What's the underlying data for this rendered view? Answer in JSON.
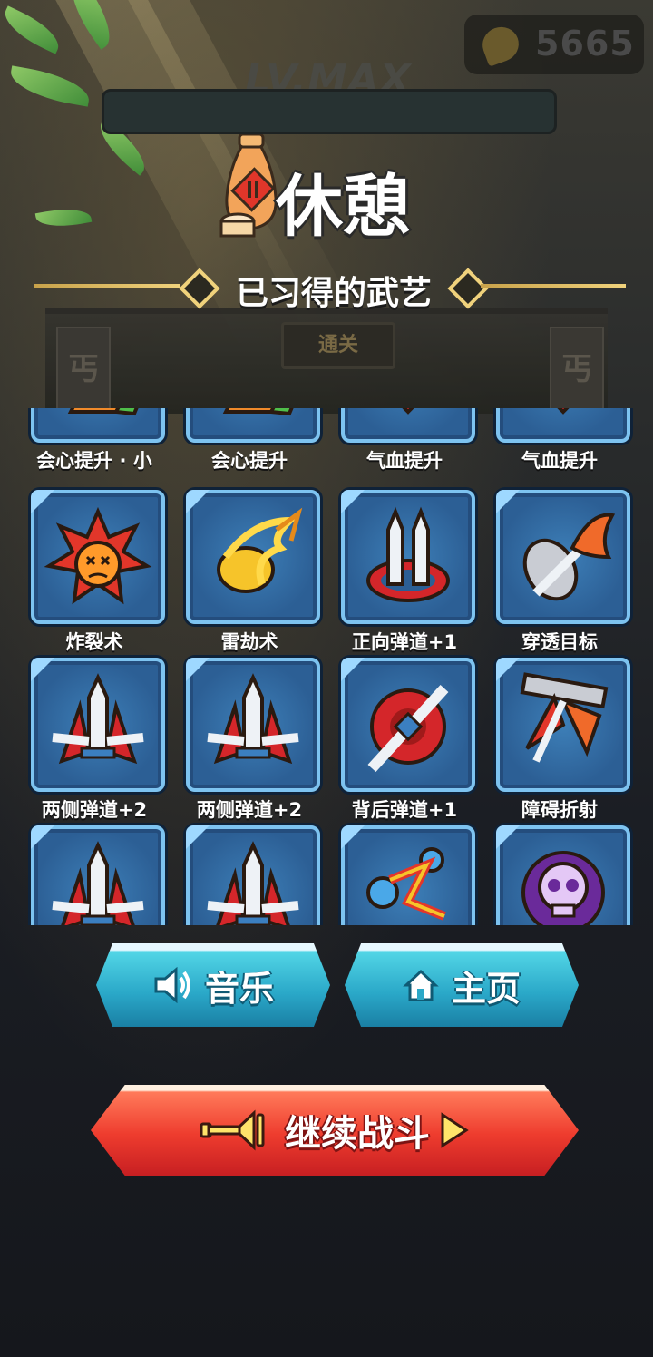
{
  "header": {
    "coins": "5665",
    "level_label": "LV.MAX",
    "title": "休憩",
    "section_title": "已习得的武艺",
    "gate_sign": "通关",
    "banner_char": "丐"
  },
  "skills": [
    {
      "label": "会心提升 · 小",
      "icon": "critical-up-icon"
    },
    {
      "label": "会心提升",
      "icon": "critical-up-icon"
    },
    {
      "label": "气血提升",
      "icon": "health-up-icon"
    },
    {
      "label": "气血提升",
      "icon": "health-up-icon"
    },
    {
      "label": "炸裂术",
      "icon": "explosion-icon"
    },
    {
      "label": "雷劫术",
      "icon": "lightning-icon"
    },
    {
      "label": "正向弹道+1",
      "icon": "forward-projectile-icon"
    },
    {
      "label": "穿透目标",
      "icon": "pierce-icon"
    },
    {
      "label": "两侧弹道+2",
      "icon": "side-projectile-icon"
    },
    {
      "label": "两侧弹道+2",
      "icon": "side-projectile-icon"
    },
    {
      "label": "背后弹道+1",
      "icon": "rear-projectile-icon"
    },
    {
      "label": "障碍折射",
      "icon": "ricochet-icon"
    },
    {
      "label": "",
      "icon": "side-projectile-icon"
    },
    {
      "label": "",
      "icon": "side-projectile-icon"
    },
    {
      "label": "",
      "icon": "bounce-ghost-icon"
    },
    {
      "label": "",
      "icon": "poison-skull-icon"
    }
  ],
  "buttons": {
    "music": "音乐",
    "home": "主页",
    "continue": "继续战斗"
  },
  "colors": {
    "tile_bg": "#2c5f95",
    "tile_border": "#7dc3f0",
    "button_blue": "#2aa8c8",
    "button_red": "#ee3c2e",
    "section_gold": "#f0d27c"
  }
}
